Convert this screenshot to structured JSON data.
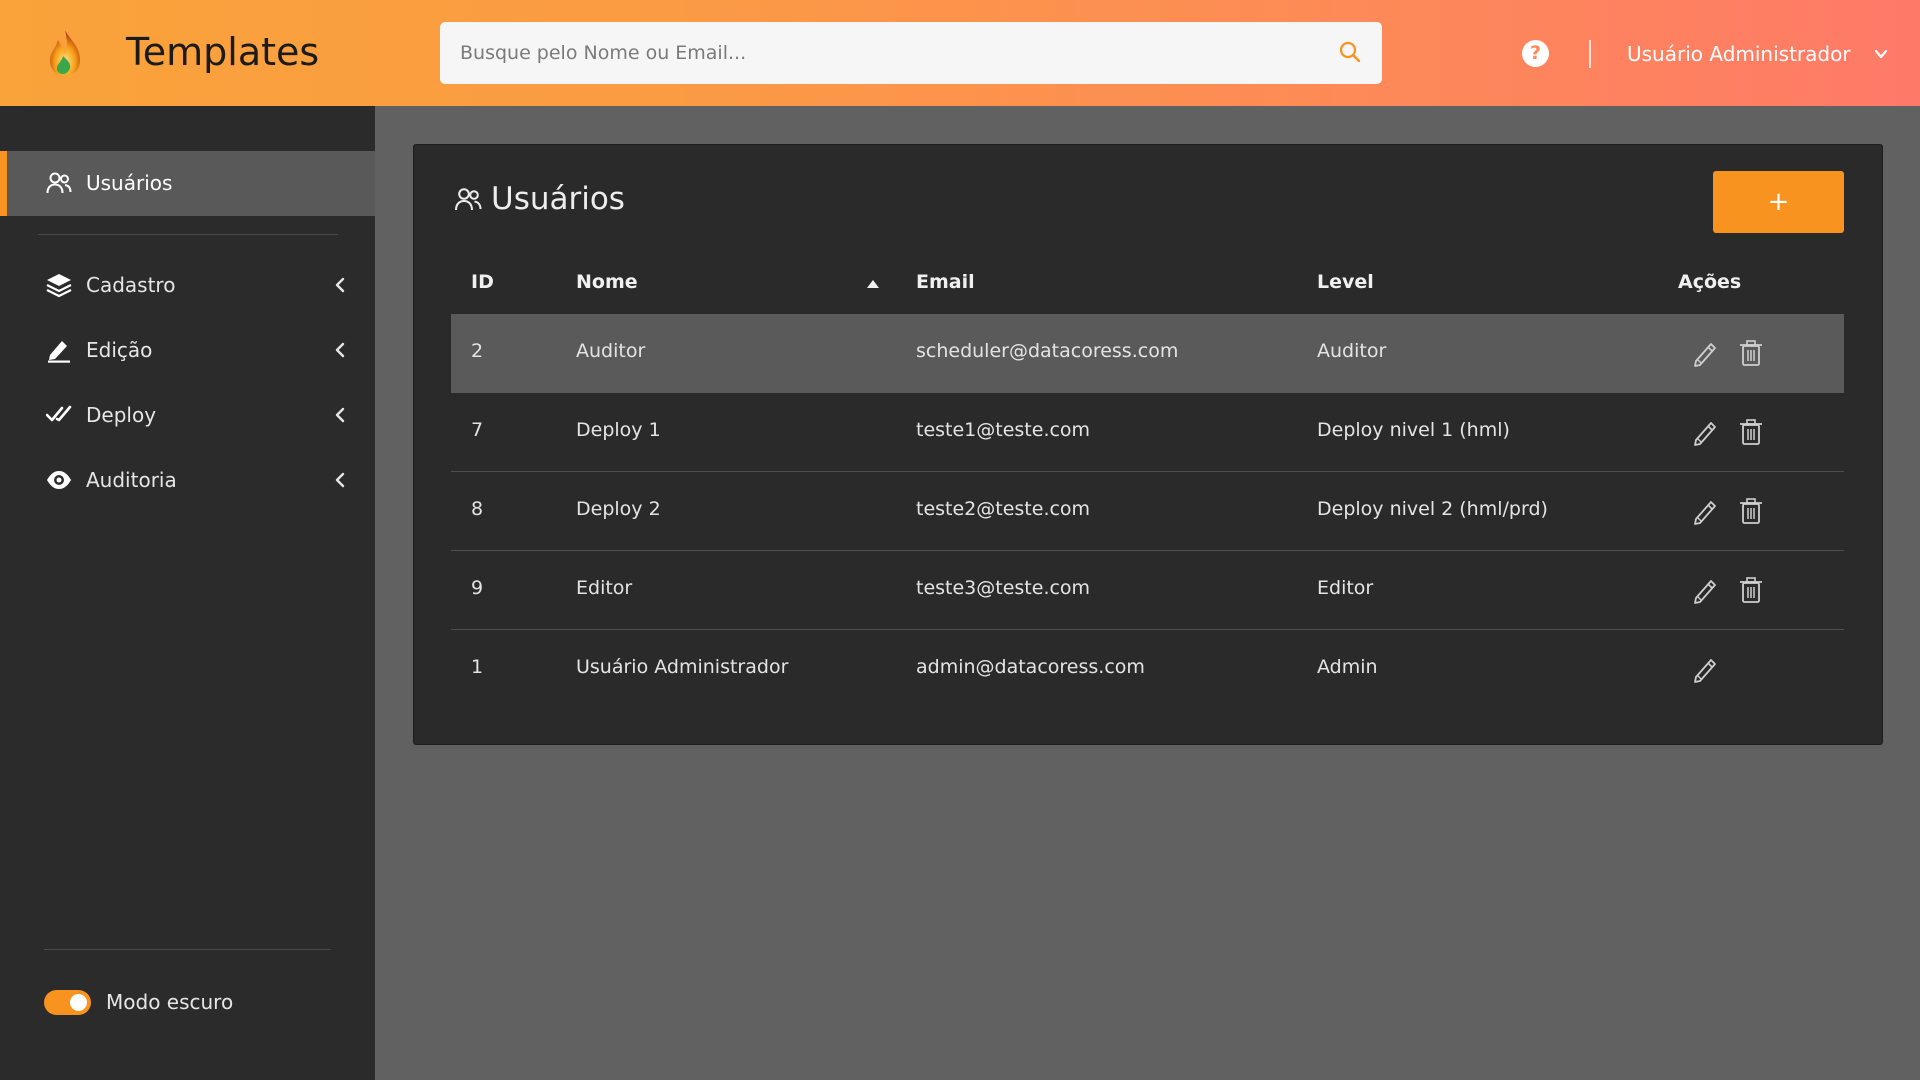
{
  "header": {
    "title": "Templates",
    "search_placeholder": "Busque pelo Nome ou Email...",
    "help_label": "?",
    "user_name": "Usuário Administrador"
  },
  "sidebar": {
    "active": {
      "label": "Usuários",
      "icon": "users-icon"
    },
    "items": [
      {
        "label": "Cadastro",
        "icon": "layers-icon"
      },
      {
        "label": "Edição",
        "icon": "pen-icon"
      },
      {
        "label": "Deploy",
        "icon": "double-check-icon"
      },
      {
        "label": "Auditoria",
        "icon": "eye-icon"
      }
    ],
    "dark_mode_label": "Modo escuro",
    "dark_mode_on": true
  },
  "colors": {
    "accent": "#f8931f",
    "header_gradient_start": "#f9a33a",
    "header_gradient_end": "#fe7a68",
    "sidebar_bg": "#2b2b2b",
    "card_bg": "#2a2a2a",
    "page_bg": "#616161"
  },
  "main": {
    "title": "Usuários",
    "add_button_label": "+",
    "columns": [
      "ID",
      "Nome",
      "Email",
      "Level",
      "Ações"
    ],
    "rows": [
      {
        "id": "2",
        "nome": "Auditor",
        "email": "scheduler@datacoress.com",
        "level": "Auditor",
        "can_delete": true
      },
      {
        "id": "7",
        "nome": "Deploy 1",
        "email": "teste1@teste.com",
        "level": "Deploy nivel 1 (hml)",
        "can_delete": true
      },
      {
        "id": "8",
        "nome": "Deploy 2",
        "email": "teste2@teste.com",
        "level": "Deploy nivel 2 (hml/prd)",
        "can_delete": true
      },
      {
        "id": "9",
        "nome": "Editor",
        "email": "teste3@teste.com",
        "level": "Editor",
        "can_delete": true
      },
      {
        "id": "1",
        "nome": "Usuário Administrador",
        "email": "admin@datacoress.com",
        "level": "Admin",
        "can_delete": false
      }
    ]
  }
}
